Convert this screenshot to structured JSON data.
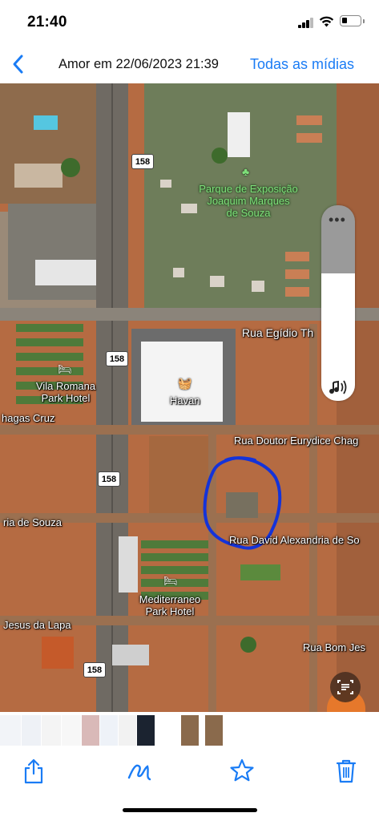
{
  "status_bar": {
    "time": "21:40",
    "icons": [
      "cellular-signal-icon",
      "wifi-icon",
      "battery-icon"
    ]
  },
  "nav": {
    "back_icon": "chevron-left-icon",
    "title": "Amor em 22/06/2023 21:39",
    "action": "Todas as mídias"
  },
  "photo": {
    "type": "map-satellite-screenshot",
    "map_labels": {
      "park_line1": "Parque de Exposição",
      "park_line2": "Joaquim Marques",
      "park_line3": "de Souza",
      "rua_egidio": "Rua Egídio Th",
      "vila_romana_line1": "Vila Romana",
      "vila_romana_line2": "Park Hotel",
      "havan": "Havan",
      "chagas_cruz": "hagas Cruz",
      "rua_doutor": "Rua Doutor Eurydice Chag",
      "ria_de_souza": "ria de Souza",
      "rua_david": "Rua David Alexandria de So",
      "mediterraneo_line1": "Mediterraneo",
      "mediterraneo_line2": "Park Hotel",
      "jesus_da_lapa": "Jesus da Lapa",
      "rua_bom_jes": "Rua Bom Jes"
    },
    "road_shields": [
      "158",
      "158",
      "158",
      "158"
    ],
    "annotation": {
      "shape": "freehand-loop",
      "color": "#1433d9"
    },
    "colors": {
      "soil": "#b56b42",
      "road": "#6f6a63",
      "vegetation": "#4f7a3a",
      "building": "#e8e8e8"
    }
  },
  "volume_hud": {
    "level": 0.65,
    "menu_icon": "more-dots-icon",
    "speaker_icon": "speaker-wave-icon"
  },
  "live_text_button": {
    "icon": "live-text-icon"
  },
  "thumbnails": {
    "count": 10
  },
  "toolbar": {
    "share_icon": "share-icon",
    "markup_icon": "markup-pen-icon",
    "favorite_icon": "star-icon",
    "delete_icon": "trash-icon",
    "accent": "#1a7cf5"
  }
}
